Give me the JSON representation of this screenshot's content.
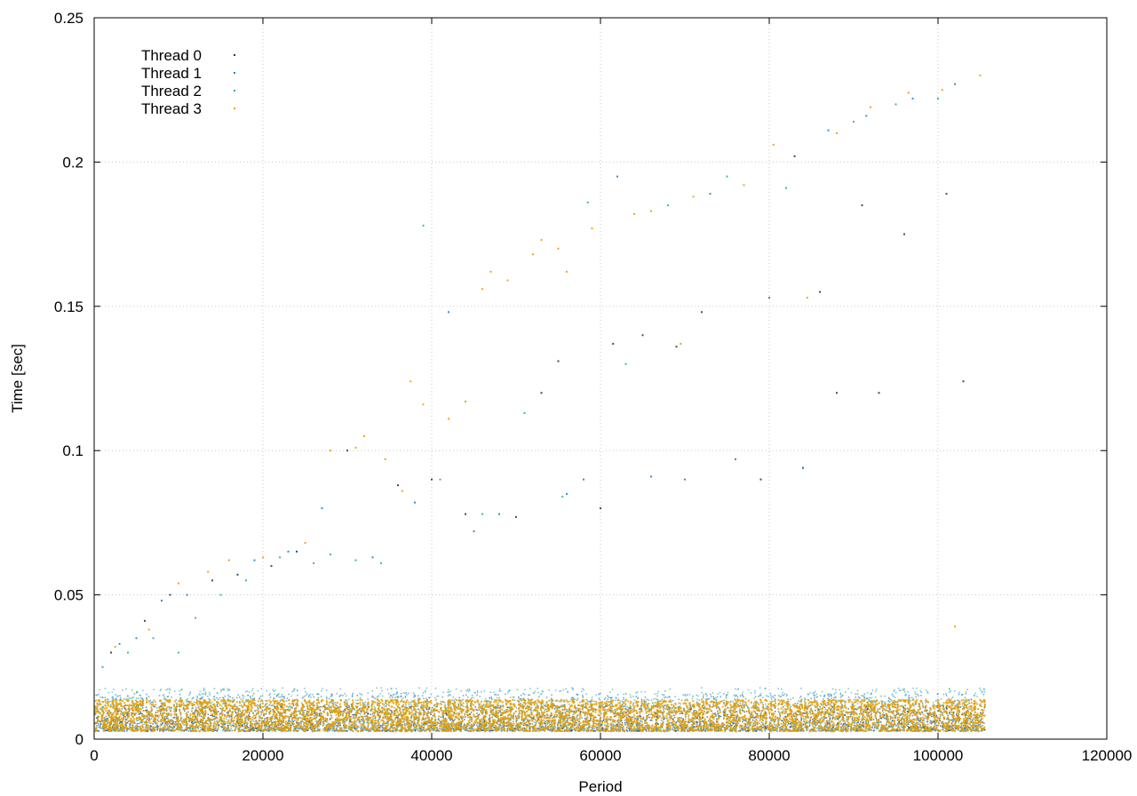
{
  "chart_data": {
    "type": "scatter",
    "title": "",
    "xlabel": "Period",
    "ylabel": "Time [sec]",
    "xlim": [
      0,
      120000
    ],
    "ylim": [
      0,
      0.25
    ],
    "x_ticks": [
      "0",
      "20000",
      "40000",
      "60000",
      "80000",
      "100000",
      "120000"
    ],
    "y_ticks": [
      "0",
      "0.05",
      "0.1",
      "0.15",
      "0.2",
      "0.25"
    ],
    "x_tick_values": [
      0,
      20000,
      40000,
      60000,
      80000,
      100000,
      120000
    ],
    "y_tick_values": [
      0,
      0.05,
      0.1,
      0.15,
      0.2,
      0.25
    ],
    "grid": true,
    "legend_position": "top-left",
    "series": [
      {
        "name": "Thread 0",
        "color": "#1f3a5a",
        "band": {
          "x_range": [
            0,
            105500
          ],
          "y_low": 0.003,
          "y_high": 0.012
        },
        "outliers": [
          [
            2000,
            0.03
          ],
          [
            6000,
            0.041
          ],
          [
            9000,
            0.05
          ],
          [
            14000,
            0.055
          ],
          [
            17000,
            0.057
          ],
          [
            21000,
            0.06
          ],
          [
            24000,
            0.065
          ],
          [
            30000,
            0.1
          ],
          [
            36000,
            0.088
          ],
          [
            40000,
            0.09
          ],
          [
            44000,
            0.078
          ],
          [
            50000,
            0.077
          ],
          [
            53000,
            0.12
          ],
          [
            55000,
            0.131
          ],
          [
            60000,
            0.08
          ],
          [
            61500,
            0.137
          ],
          [
            65000,
            0.14
          ],
          [
            69000,
            0.136
          ],
          [
            72000,
            0.148
          ],
          [
            79000,
            0.09
          ],
          [
            83000,
            0.202
          ],
          [
            84000,
            0.094
          ],
          [
            86000,
            0.155
          ],
          [
            88000,
            0.12
          ],
          [
            91000,
            0.185
          ],
          [
            93000,
            0.12
          ],
          [
            96000,
            0.175
          ],
          [
            101000,
            0.189
          ],
          [
            103000,
            0.124
          ]
        ]
      },
      {
        "name": "Thread 1",
        "color": "#2a80b9",
        "band": {
          "x_range": [
            0,
            105500
          ],
          "y_low": 0.003,
          "y_high": 0.016
        },
        "outliers": [
          [
            3000,
            0.033
          ],
          [
            5000,
            0.035
          ],
          [
            8000,
            0.048
          ],
          [
            11000,
            0.05
          ],
          [
            19000,
            0.062
          ],
          [
            23000,
            0.065
          ],
          [
            27000,
            0.08
          ],
          [
            33000,
            0.063
          ],
          [
            38000,
            0.082
          ],
          [
            42000,
            0.148
          ],
          [
            45000,
            0.072
          ],
          [
            48000,
            0.078
          ],
          [
            56000,
            0.085
          ],
          [
            58000,
            0.09
          ],
          [
            62000,
            0.195
          ],
          [
            66000,
            0.091
          ],
          [
            70000,
            0.09
          ],
          [
            73000,
            0.189
          ],
          [
            76000,
            0.097
          ],
          [
            80000,
            0.153
          ],
          [
            84000,
            0.094
          ],
          [
            87000,
            0.211
          ],
          [
            91500,
            0.216
          ],
          [
            97000,
            0.222
          ],
          [
            102000,
            0.227
          ]
        ]
      },
      {
        "name": "Thread 2",
        "color": "#3aa6b2",
        "band": {
          "x_range": [
            0,
            105500
          ],
          "y_low": 0.003,
          "y_high": 0.018
        },
        "outliers": [
          [
            1000,
            0.025
          ],
          [
            4000,
            0.03
          ],
          [
            7000,
            0.035
          ],
          [
            10000,
            0.03
          ],
          [
            12000,
            0.042
          ],
          [
            15000,
            0.05
          ],
          [
            18000,
            0.055
          ],
          [
            22000,
            0.063
          ],
          [
            26000,
            0.061
          ],
          [
            28000,
            0.064
          ],
          [
            31000,
            0.062
          ],
          [
            34000,
            0.061
          ],
          [
            39000,
            0.178
          ],
          [
            41000,
            0.09
          ],
          [
            46000,
            0.078
          ],
          [
            51000,
            0.113
          ],
          [
            55500,
            0.084
          ],
          [
            58500,
            0.186
          ],
          [
            63000,
            0.13
          ],
          [
            68000,
            0.185
          ],
          [
            75000,
            0.195
          ],
          [
            82000,
            0.191
          ],
          [
            90000,
            0.214
          ],
          [
            95000,
            0.22
          ],
          [
            100000,
            0.222
          ]
        ]
      },
      {
        "name": "Thread 3",
        "color": "#e69f00",
        "band": {
          "x_range": [
            0,
            105500
          ],
          "y_low": 0.003,
          "y_high": 0.014
        },
        "outliers": [
          [
            2500,
            0.032
          ],
          [
            6500,
            0.038
          ],
          [
            10000,
            0.054
          ],
          [
            13500,
            0.058
          ],
          [
            16000,
            0.062
          ],
          [
            20000,
            0.063
          ],
          [
            25000,
            0.068
          ],
          [
            28000,
            0.1
          ],
          [
            31000,
            0.101
          ],
          [
            32000,
            0.105
          ],
          [
            34500,
            0.097
          ],
          [
            36500,
            0.086
          ],
          [
            37500,
            0.124
          ],
          [
            39000,
            0.116
          ],
          [
            42000,
            0.111
          ],
          [
            44000,
            0.117
          ],
          [
            46000,
            0.156
          ],
          [
            47000,
            0.162
          ],
          [
            49000,
            0.159
          ],
          [
            52000,
            0.168
          ],
          [
            53000,
            0.173
          ],
          [
            55000,
            0.17
          ],
          [
            56000,
            0.162
          ],
          [
            59000,
            0.177
          ],
          [
            64000,
            0.182
          ],
          [
            66000,
            0.183
          ],
          [
            69500,
            0.137
          ],
          [
            71000,
            0.188
          ],
          [
            77000,
            0.192
          ],
          [
            80500,
            0.206
          ],
          [
            84500,
            0.153
          ],
          [
            88000,
            0.21
          ],
          [
            92000,
            0.219
          ],
          [
            96500,
            0.224
          ],
          [
            100500,
            0.225
          ],
          [
            102000,
            0.039
          ],
          [
            105000,
            0.23
          ]
        ]
      }
    ]
  }
}
